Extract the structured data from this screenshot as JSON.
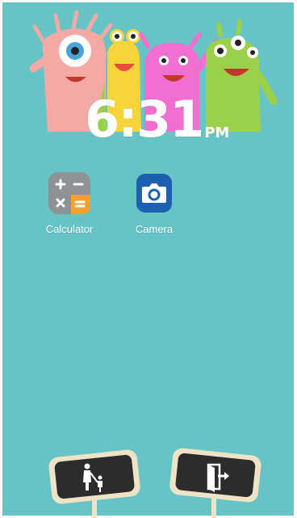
{
  "clock": {
    "time": "6:31",
    "ampm": "PM"
  },
  "apps": [
    {
      "label": "Calculator",
      "icon": "calculator-icon"
    },
    {
      "label": "Camera",
      "icon": "camera-icon"
    }
  ],
  "bottom_signs": [
    {
      "icon": "parent-child-icon"
    },
    {
      "icon": "exit-door-icon"
    }
  ],
  "colors": {
    "background": "#66c4c6",
    "sign_board": "#2c2c2c",
    "sign_frame": "#efe3c6"
  }
}
